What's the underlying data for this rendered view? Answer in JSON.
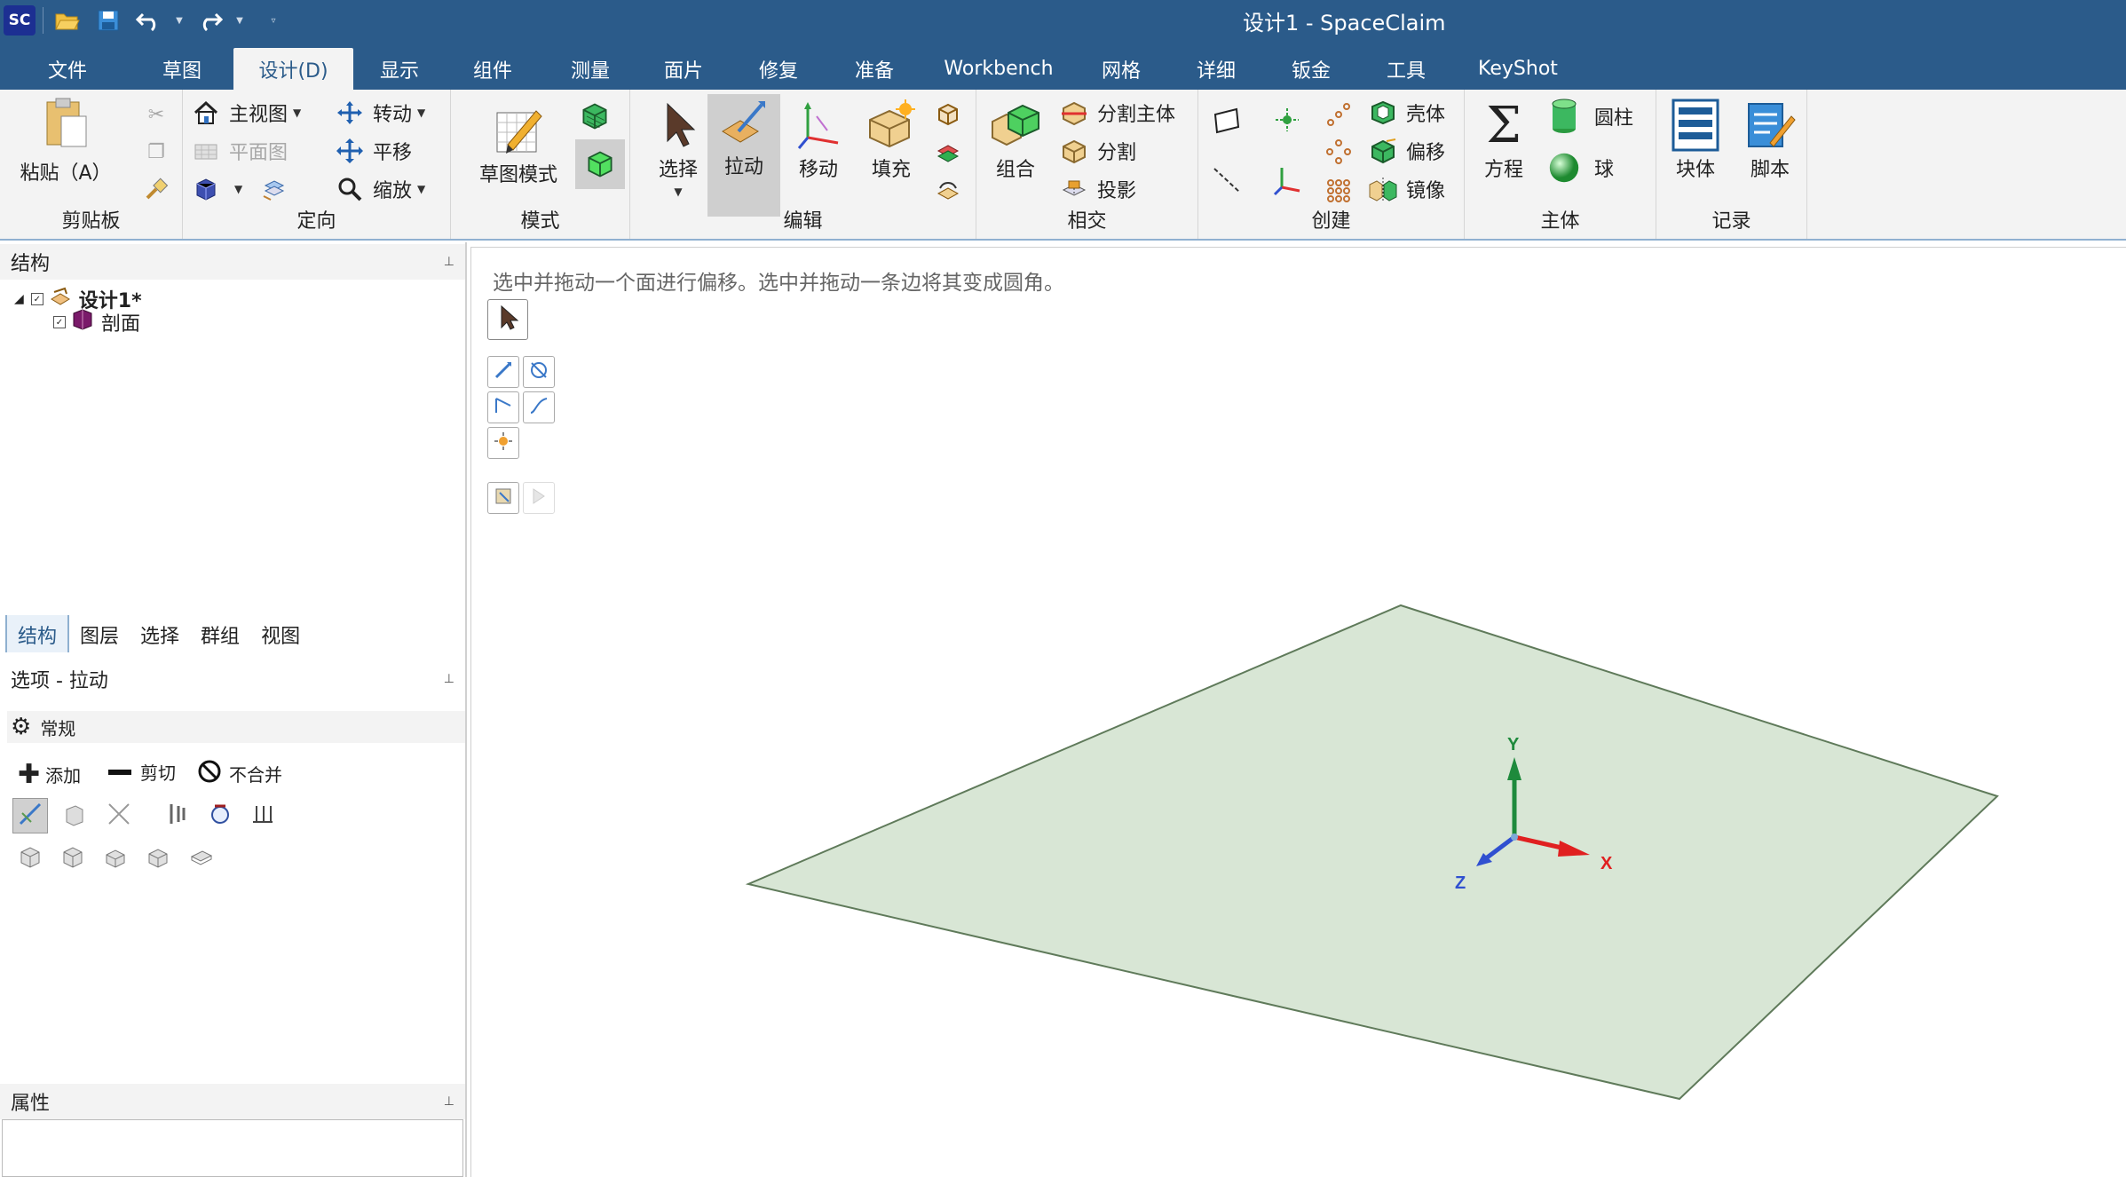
{
  "app": {
    "logo_text": "SC",
    "window_title": "设计1 - SpaceClaim"
  },
  "quick_access": [
    "open-icon",
    "save-icon",
    "undo-icon",
    "redo-icon",
    "customize-icon"
  ],
  "menu": {
    "tabs": [
      "文件",
      "草图",
      "设计(D)",
      "显示",
      "组件",
      "测量",
      "面片",
      "修复",
      "准备",
      "Workbench",
      "网格",
      "详细",
      "钣金",
      "工具",
      "KeyShot"
    ],
    "active": "设计(D)"
  },
  "ribbon": {
    "clipboard": {
      "label": "剪贴板",
      "paste": "粘贴（A）"
    },
    "orient": {
      "label": "定向",
      "home": "主视图",
      "plan": "平面图",
      "spin": "转动",
      "pan": "平移",
      "zoom": "缩放"
    },
    "mode": {
      "label": "模式",
      "sketch_mode": "草图模式"
    },
    "edit": {
      "label": "编辑",
      "select": "选择",
      "pull": "拉动",
      "move": "移动",
      "fill": "填充"
    },
    "intersect": {
      "label": "相交",
      "combine": "组合",
      "split_body": "分割主体",
      "split": "分割",
      "project": "投影"
    },
    "create": {
      "label": "创建",
      "shell": "壳体",
      "offset": "偏移",
      "mirror": "镜像"
    },
    "body": {
      "label": "主体",
      "equation": "方程",
      "cylinder": "圆柱",
      "sphere": "球"
    },
    "record": {
      "label": "记录",
      "block": "块体",
      "script": "脚本"
    }
  },
  "structure_panel": {
    "title": "结构",
    "tree": [
      {
        "label": "设计1*",
        "checked": true,
        "expanded": true
      },
      {
        "label": "剖面",
        "checked": true
      }
    ],
    "tabs": [
      "结构",
      "图层",
      "选择",
      "群组",
      "视图"
    ],
    "active_tab": "结构"
  },
  "options_panel": {
    "title": "选项 - 拉动",
    "general": "常规",
    "add": "添加",
    "cut": "剪切",
    "no_merge": "不合并"
  },
  "properties_panel": {
    "title": "属性"
  },
  "viewport": {
    "hint": "选中并拖动一个面进行偏移。选中并拖动一条边将其变成圆角。",
    "axes": {
      "x": "X",
      "y": "Y",
      "z": "Z"
    },
    "colors": {
      "plane_fill": "#d8e6d5",
      "plane_edge": "#5f7a5a",
      "x_axis": "#e02020",
      "y_axis": "#1e8a3c",
      "z_axis": "#3050d0"
    }
  }
}
